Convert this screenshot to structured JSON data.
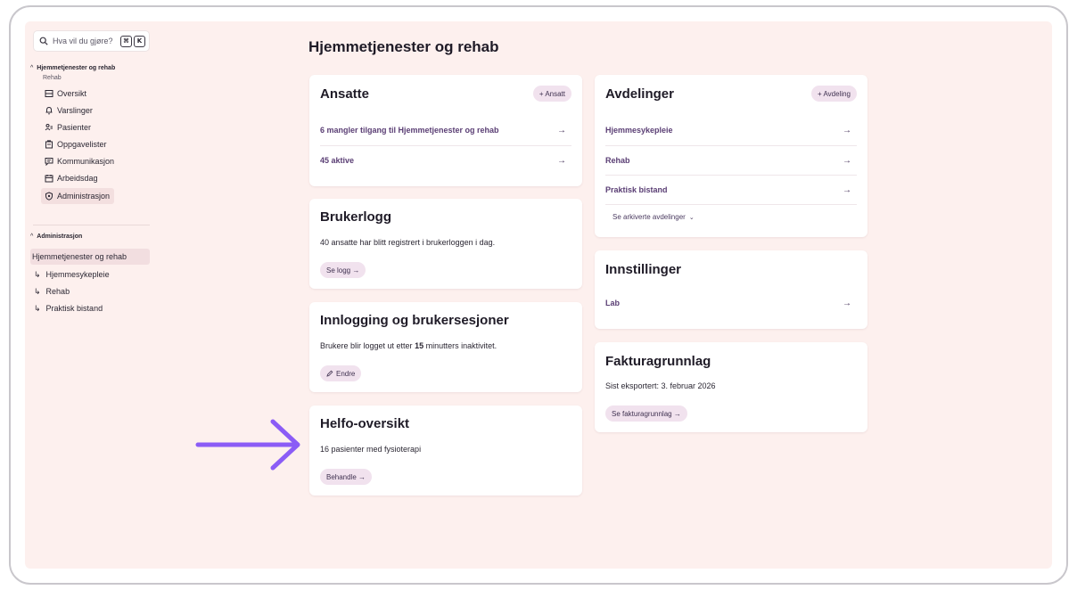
{
  "search": {
    "placeholder": "Hva vil du gjøre?",
    "shortcut_cmd": "⌘",
    "shortcut_key": "K"
  },
  "sidebar": {
    "section1": {
      "title": "Hjemmetjenester og rehab",
      "subtitle": "Rehab"
    },
    "items": [
      {
        "label": "Oversikt",
        "icon": "list-icon"
      },
      {
        "label": "Varslinger",
        "icon": "bell-icon"
      },
      {
        "label": "Pasienter",
        "icon": "patients-icon"
      },
      {
        "label": "Oppgavelister",
        "icon": "tasklist-icon"
      },
      {
        "label": "Kommunikasjon",
        "icon": "chat-icon"
      },
      {
        "label": "Arbeidsdag",
        "icon": "calendar-icon"
      },
      {
        "label": "Administrasjon",
        "icon": "shield-icon",
        "active": true
      }
    ],
    "section2": {
      "title": "Administrasjon"
    },
    "admin_items": [
      {
        "label": "Hjemmetjenester og rehab",
        "active": true
      },
      {
        "label": "Hjemmesykepleie"
      },
      {
        "label": "Rehab"
      },
      {
        "label": "Praktisk bistand"
      }
    ]
  },
  "main": {
    "title": "Hjemmetjenester og rehab",
    "ansatte": {
      "title": "Ansatte",
      "add_label": "+ Ansatt",
      "rows": [
        "6 mangler tilgang til Hjemmetjenester og rehab",
        "45 aktive"
      ]
    },
    "brukerlogg": {
      "title": "Brukerlogg",
      "text": "40 ansatte har blitt registrert i brukerloggen i dag.",
      "button": "Se logg →"
    },
    "innlogging": {
      "title": "Innlogging og brukersesjoner",
      "text_before": "Brukere blir logget ut etter ",
      "text_bold": "15",
      "text_after": " minutters inaktivitet.",
      "button": "Endre"
    },
    "helfo": {
      "title": "Helfo-oversikt",
      "text": "16 pasienter med fysioterapi",
      "button": "Behandle →"
    },
    "avdelinger": {
      "title": "Avdelinger",
      "add_label": "+ Avdeling",
      "rows": [
        "Hjemmesykepleie",
        "Rehab",
        "Praktisk bistand"
      ],
      "archived": "Se arkiverte avdelinger"
    },
    "innstillinger": {
      "title": "Innstillinger",
      "rows": [
        "Lab"
      ]
    },
    "faktura": {
      "title": "Fakturagrunnlag",
      "text": "Sist eksportert: 3. februar 2026",
      "button": "Se fakturagrunnlag →"
    },
    "row_arrow": "→"
  },
  "colors": {
    "background": "#fdf0ee",
    "accent": "#8b5cf6",
    "pill": "#f1e2ee",
    "link_text": "#5a3e74"
  }
}
